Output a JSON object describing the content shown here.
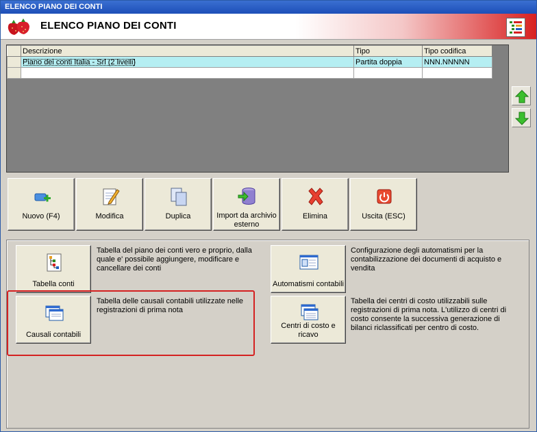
{
  "window": {
    "title": "ELENCO PIANO DEI CONTI"
  },
  "header": {
    "title": "ELENCO PIANO DEI CONTI",
    "logo_icon": "strawberries-icon",
    "menu_icon": "tree-list-icon"
  },
  "grid": {
    "columns": [
      "Descrizione",
      "Tipo",
      "Tipo codifica"
    ],
    "rows": [
      {
        "descrizione": "Piano dei conti Italia - Srl (2 livelli)",
        "tipo": "Partita doppia",
        "tipo_codifica": "NNN.NNNNN"
      }
    ]
  },
  "nav": {
    "up_icon": "arrow-up-icon",
    "down_icon": "arrow-down-icon"
  },
  "toolbar": {
    "nuovo": "Nuovo (F4)",
    "modifica": "Modifica",
    "duplica": "Duplica",
    "import_line1": "Import da archivio",
    "import_line2": "esterno",
    "elimina": "Elimina",
    "uscita": "Uscita (ESC)"
  },
  "functions": {
    "tabella_conti": {
      "label": "Tabella conti",
      "desc": "Tabella del piano dei conti vero e proprio, dalla quale e' possibile aggiungere, modificare e cancellare dei conti"
    },
    "causali": {
      "label": "Causali contabili",
      "desc": "Tabella delle causali contabili utilizzate nelle registrazioni di prima nota"
    },
    "automatismi": {
      "label": "Automatismi contabili",
      "desc": "Configurazione degli automatismi per la contabilizzazione dei documenti di acquisto e vendita"
    },
    "centri": {
      "label_line1": "Centri di costo e",
      "label_line2": "ricavo",
      "desc": "Tabella dei centri di costo utilizzabili sulle registrazioni di prima nota. L'utilizzo di centri di costo consente la successiva generazione di bilanci riclassificati per centro di costo."
    }
  },
  "colors": {
    "title_bar": "#1d4fb8",
    "highlight": "#d42020",
    "selected_row": "#b5eef2"
  }
}
